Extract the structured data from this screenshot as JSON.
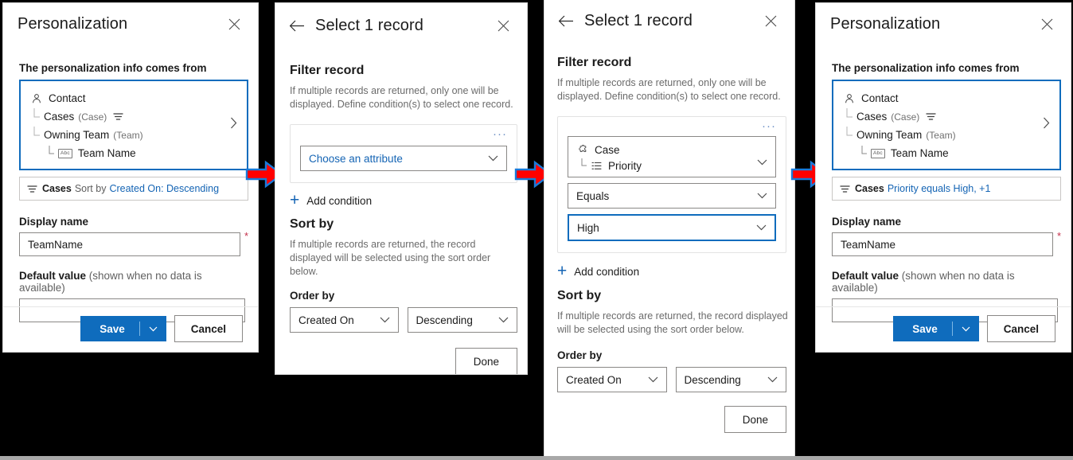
{
  "colors": {
    "accent": "#0f6cbd",
    "link": "#1464b4",
    "arrow_fill": "#ff0000",
    "arrow_outline": "#1a7ad9",
    "required_star": "#c4314b",
    "background": "#000000"
  },
  "panel1": {
    "title": "Personalization",
    "close_label": "✕",
    "source_label": "The personalization info comes from",
    "tree": [
      {
        "icon": "contact-person-icon",
        "label": "Contact",
        "qualifier": "",
        "has_filter": false,
        "indent": 0
      },
      {
        "icon": "none",
        "label": "Cases",
        "qualifier": "(Case)",
        "has_filter": true,
        "indent": 1
      },
      {
        "icon": "none",
        "label": "Owning Team",
        "qualifier": "(Team)",
        "has_filter": false,
        "indent": 1
      },
      {
        "icon": "abc-text-field-icon",
        "label": "Team Name",
        "qualifier": "",
        "has_filter": false,
        "indent": 2
      }
    ],
    "expand_chevron": "›",
    "summary": {
      "entity": "Cases",
      "middle": "Sort by",
      "link": "Created On: Descending"
    },
    "display_name_label": "Display name",
    "display_name_value": "TeamName",
    "display_name_required": "*",
    "default_value_label_bold": "Default value",
    "default_value_label_light": "(shown when no data is available)",
    "default_value": "",
    "save_label": "Save",
    "save_split_caret": "⌄",
    "cancel_label": "Cancel"
  },
  "panel2": {
    "back_label": "←",
    "title": "Select 1 record",
    "close_label": "✕",
    "filter_heading": "Filter record",
    "filter_desc": "If multiple records are returned, only one will be displayed. Define condition(s) to select one record.",
    "card_menu": "···",
    "attribute_placeholder": "Choose an attribute",
    "add_condition_label": "Add condition",
    "add_condition_plus": "+",
    "sort_heading": "Sort by",
    "sort_desc": "If multiple records are returned, the record displayed will be selected using the sort order below.",
    "order_by_label": "Order by",
    "order_field": "Created On",
    "order_direction": "Descending",
    "done_label": "Done"
  },
  "panel3": {
    "back_label": "←",
    "title": "Select 1 record",
    "close_label": "✕",
    "filter_heading": "Filter record",
    "filter_desc": "If multiple records are returned, only one will be displayed. Define condition(s) to select one record.",
    "card_menu": "···",
    "attribute_entity": "Case",
    "attribute_field": "Priority",
    "operator_value": "Equals",
    "value_value": "High",
    "add_condition_label": "Add condition",
    "add_condition_plus": "+",
    "sort_heading": "Sort by",
    "sort_desc": "If multiple records are returned, the record displayed will be selected using the sort order below.",
    "order_by_label": "Order by",
    "order_field": "Created On",
    "order_direction": "Descending",
    "done_label": "Done"
  },
  "panel4": {
    "title": "Personalization",
    "close_label": "✕",
    "source_label": "The personalization info comes from",
    "tree": [
      {
        "icon": "contact-person-icon",
        "label": "Contact",
        "qualifier": "",
        "has_filter": false,
        "indent": 0
      },
      {
        "icon": "none",
        "label": "Cases",
        "qualifier": "(Case)",
        "has_filter": true,
        "indent": 1
      },
      {
        "icon": "none",
        "label": "Owning Team",
        "qualifier": "(Team)",
        "has_filter": false,
        "indent": 1
      },
      {
        "icon": "abc-text-field-icon",
        "label": "Team Name",
        "qualifier": "",
        "has_filter": false,
        "indent": 2
      }
    ],
    "expand_chevron": "›",
    "summary": {
      "entity": "Cases",
      "link": "Priority equals High, +1"
    },
    "display_name_label": "Display name",
    "display_name_value": "TeamName",
    "display_name_required": "*",
    "default_value_label_bold": "Default value",
    "default_value_label_light": "(shown when no data is available)",
    "default_value": "",
    "save_label": "Save",
    "save_split_caret": "⌄",
    "cancel_label": "Cancel"
  },
  "arrows": [
    {
      "name": "step-arrow-1"
    },
    {
      "name": "step-arrow-2"
    },
    {
      "name": "step-arrow-3"
    }
  ]
}
